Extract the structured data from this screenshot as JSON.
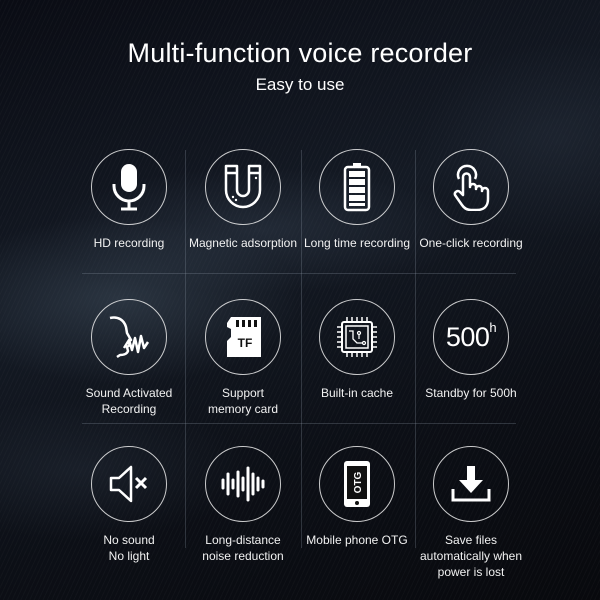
{
  "header": {
    "title": "Multi-function voice recorder",
    "subtitle": "Easy to use"
  },
  "features": [
    {
      "icon": "microphone-icon",
      "label": "HD recording"
    },
    {
      "icon": "magnet-icon",
      "label": "Magnetic adsorption"
    },
    {
      "icon": "battery-icon",
      "label": "Long time recording"
    },
    {
      "icon": "tap-finger-icon",
      "label": "One-click recording"
    },
    {
      "icon": "voice-activation-icon",
      "label": "Sound Activated\nRecording"
    },
    {
      "icon": "tf-card-icon",
      "label": "Support\nmemory card",
      "icon_text": "TF"
    },
    {
      "icon": "chip-icon",
      "label": "Built-in cache"
    },
    {
      "icon": "standby-hours-icon",
      "label": "Standby for 500h",
      "icon_text": "500",
      "icon_unit": "h"
    },
    {
      "icon": "mute-speaker-icon",
      "label": "No sound\nNo light"
    },
    {
      "icon": "sound-wave-icon",
      "label": "Long-distance\nnoise reduction"
    },
    {
      "icon": "phone-otg-icon",
      "label": "Mobile phone OTG",
      "icon_text": "OTG"
    },
    {
      "icon": "download-save-icon",
      "label": "Save files\nautomatically when\npower is lost"
    }
  ]
}
